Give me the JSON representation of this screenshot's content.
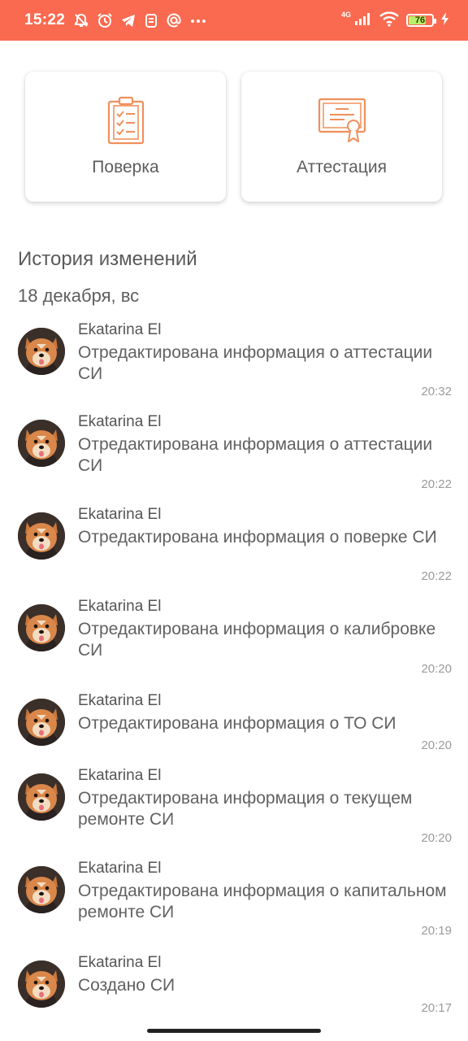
{
  "status_bar": {
    "time": "15:22",
    "network_type": "4G",
    "battery_level": "76",
    "battery_percent": 76,
    "bar_color": "#fa6a50",
    "icons": [
      "mute-icon",
      "alarm-icon",
      "telegram-icon",
      "app-icon",
      "at-icon",
      "more-icon",
      "signal-icon",
      "wifi-icon",
      "battery-icon",
      "charging-icon"
    ]
  },
  "cards": [
    {
      "label": "Поверка",
      "icon": "checklist-icon"
    },
    {
      "label": "Аттестация",
      "icon": "certificate-icon"
    }
  ],
  "accent_color": "#f0905c",
  "history": {
    "title": "История изменений",
    "date": "18 декабря, вс",
    "entries": [
      {
        "user": "Ekatarina El",
        "text": "Отредактирована информация о аттестации СИ",
        "time": "20:32"
      },
      {
        "user": "Ekatarina El",
        "text": "Отредактирована информация о аттестации СИ",
        "time": "20:22"
      },
      {
        "user": "Ekatarina El",
        "text": "Отредактирована информация о поверке СИ",
        "time": "20:22"
      },
      {
        "user": "Ekatarina El",
        "text": "Отредактирована информация о калибровке СИ",
        "time": "20:20"
      },
      {
        "user": "Ekatarina El",
        "text": "Отредактирована информация о ТО СИ",
        "time": "20:20"
      },
      {
        "user": "Ekatarina El",
        "text": "Отредактирована информация о текущем ремонте СИ",
        "time": "20:20"
      },
      {
        "user": "Ekatarina El",
        "text": "Отредактирована информация о капитальном ремонте СИ",
        "time": "20:19"
      },
      {
        "user": "Ekatarina El",
        "text": "Создано СИ",
        "time": "20:17"
      }
    ]
  }
}
